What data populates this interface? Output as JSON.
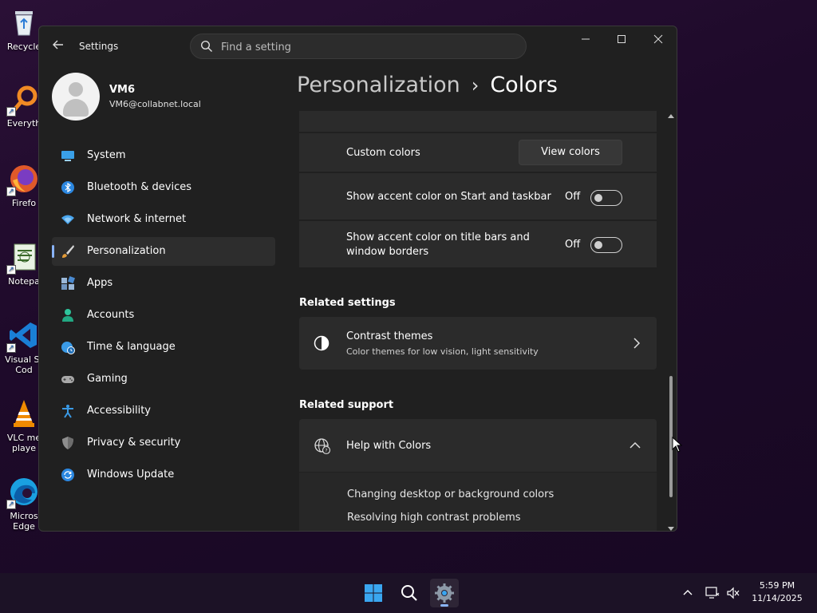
{
  "desktop": {
    "icons": [
      {
        "label": "Recycle",
        "icon": "recycle-bin-icon"
      },
      {
        "label": "Everyth",
        "icon": "everything-search-icon"
      },
      {
        "label": "Firefo",
        "icon": "firefox-icon"
      },
      {
        "label": "Notepa",
        "icon": "notepad-icon"
      },
      {
        "label": "Visual St Cod",
        "icon": "vscode-icon"
      },
      {
        "label": "VLC me playe",
        "icon": "vlc-icon"
      },
      {
        "label": "Micros Edge",
        "icon": "edge-icon"
      }
    ]
  },
  "window": {
    "app_title": "Settings",
    "search_placeholder": "Find a setting",
    "controls": {
      "minimize": "—",
      "maximize": "☐",
      "close": "✕"
    }
  },
  "profile": {
    "name": "VM6",
    "email": "VM6@collabnet.local"
  },
  "sidebar": {
    "items": [
      {
        "label": "System",
        "icon": "system-icon"
      },
      {
        "label": "Bluetooth & devices",
        "icon": "bluetooth-icon"
      },
      {
        "label": "Network & internet",
        "icon": "wifi-icon"
      },
      {
        "label": "Personalization",
        "icon": "paintbrush-icon",
        "active": true
      },
      {
        "label": "Apps",
        "icon": "apps-icon"
      },
      {
        "label": "Accounts",
        "icon": "accounts-icon"
      },
      {
        "label": "Time & language",
        "icon": "globe-clock-icon"
      },
      {
        "label": "Gaming",
        "icon": "gamepad-icon"
      },
      {
        "label": "Accessibility",
        "icon": "accessibility-icon"
      },
      {
        "label": "Privacy & security",
        "icon": "shield-icon"
      },
      {
        "label": "Windows Update",
        "icon": "update-icon"
      }
    ]
  },
  "breadcrumb": {
    "parent": "Personalization",
    "separator": "›",
    "current": "Colors"
  },
  "colors": {
    "swatches": [
      "#5b7f8c",
      "#4f6e5e",
      "#5d8a4f",
      "#4c6a5a",
      "#b08a3a",
      "#9a6a52"
    ],
    "custom_colors_label": "Custom colors",
    "view_colors_button": "View colors",
    "accent_start_label": "Show accent color on Start and taskbar",
    "accent_start_state": "Off",
    "accent_title_label_line1": "Show accent color on title bars and",
    "accent_title_label_line2": "window borders",
    "accent_title_state": "Off"
  },
  "related_settings": {
    "title": "Related settings",
    "contrast_title": "Contrast themes",
    "contrast_desc": "Color themes for low vision, light sensitivity"
  },
  "related_support": {
    "title": "Related support",
    "help_title": "Help with Colors",
    "links": [
      "Changing desktop or background colors",
      "Resolving high contrast problems"
    ]
  },
  "taskbar": {
    "time": "5:59 PM",
    "date": "11/14/2025",
    "tray_chevron": "^"
  }
}
